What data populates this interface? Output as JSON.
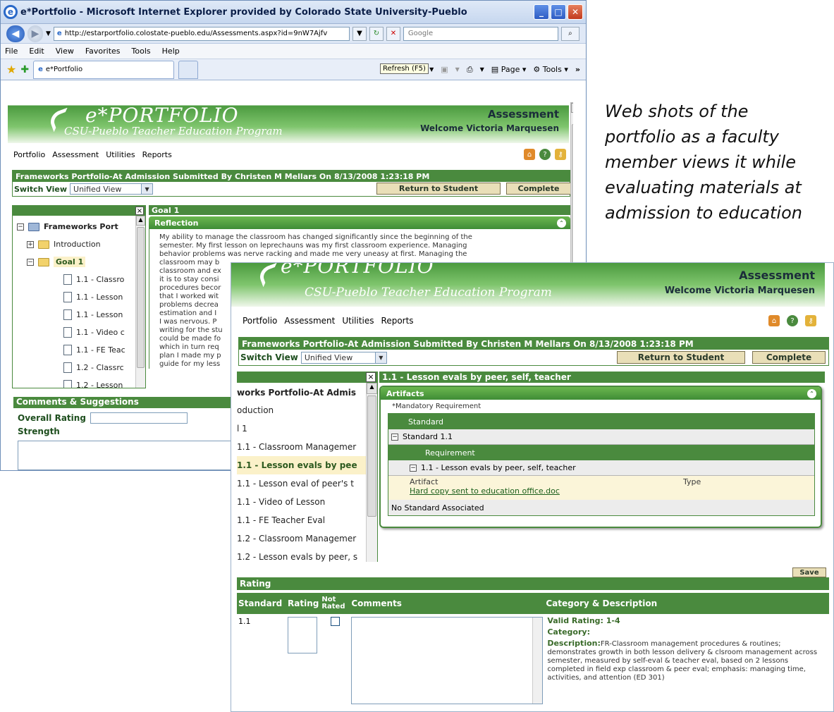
{
  "browser": {
    "title": "e*Portfolio - Microsoft Internet Explorer provided by Colorado State University-Pueblo",
    "url": "http://estarportfolio.colostate-pueblo.edu/Assessments.aspx?id=9nW7Ajfv",
    "search_placeholder": "Google",
    "menu": [
      "File",
      "Edit",
      "View",
      "Favorites",
      "Tools",
      "Help"
    ],
    "tab_label": "e*Portfolio",
    "tooltip": "Refresh (F5)",
    "page_label": "Page",
    "tools_label": "Tools"
  },
  "portal": {
    "logo_main": "e*PORTFOLIO",
    "logo_sub": "CSU-Pueblo Teacher Education Program",
    "page_heading": "Assessment",
    "welcome": "Welcome Victoria Marquesen",
    "nav": [
      "Portfolio",
      "Assessment",
      "Utilities",
      "Reports"
    ],
    "submission_banner": "Frameworks Portfolio-At Admission Submitted By Christen M Mellars On 8/13/2008 1:23:18 PM",
    "switch_view_label": "Switch View",
    "switch_view_value": "Unified View",
    "return_button": "Return to Student",
    "complete_button": "Complete",
    "close_glyph": "×"
  },
  "window1": {
    "goal_header": "Goal 1",
    "reflection_title": "Reflection",
    "tree": [
      {
        "label": "Frameworks Port",
        "kind": "root"
      },
      {
        "label": "Introduction",
        "kind": "folder"
      },
      {
        "label": "Goal 1",
        "kind": "folder-open"
      },
      {
        "label": "1.1 - Classro",
        "kind": "doc"
      },
      {
        "label": "1.1 - Lesson",
        "kind": "doc"
      },
      {
        "label": "1.1 - Lesson",
        "kind": "doc"
      },
      {
        "label": "1.1 - Video c",
        "kind": "doc"
      },
      {
        "label": "1.1 - FE Teac",
        "kind": "doc"
      },
      {
        "label": "1.2 - Classrc",
        "kind": "doc"
      },
      {
        "label": "1.2 - Lesson",
        "kind": "doc"
      }
    ],
    "reflection_lines": [
      "My ability to manage the classroom has changed significantly since the beginning of the",
      "semester. My first lesson on leprechauns was my first classroom experience. Managing",
      "behavior problems was nerve racking and made me very uneasy at first. Managing the",
      "classroom may b",
      "classroom and ex",
      "it is to stay consi",
      "procedures becor",
      "that I worked wit",
      "problems decrea",
      "estimation and I",
      "I was nervous. P",
      "writing for the stu",
      "could be made fo",
      "which in turn req",
      "plan I made my p",
      "guide for my less"
    ],
    "comments_title": "Comments & Suggestions",
    "overall_rating_label": "Overall Rating",
    "strength_label": "Strength"
  },
  "caption": {
    "lines": [
      "Web shots of the",
      "portfolio as a faculty",
      "member views it while",
      "evaluating materials at",
      "admission to education"
    ]
  },
  "window2": {
    "item_header": "1.1 - Lesson evals by peer, self, teacher",
    "tree": [
      {
        "label": "works Portfolio-At Admis",
        "bold": true
      },
      {
        "label": "oduction",
        "bold": false
      },
      {
        "label": "l 1",
        "bold": false
      },
      {
        "label": "1.1 - Classroom Managemer",
        "bold": false
      },
      {
        "label": "1.1 - Lesson evals by pee",
        "bold": true,
        "selected": true
      },
      {
        "label": "1.1 - Lesson eval of peer's t",
        "bold": false
      },
      {
        "label": "1.1 - Video of Lesson",
        "bold": false
      },
      {
        "label": "1.1 - FE Teacher Eval",
        "bold": false
      },
      {
        "label": "1.2 - Classroom Managemer",
        "bold": false
      },
      {
        "label": "1.2 - Lesson evals by peer, s",
        "bold": false
      }
    ],
    "artifacts_title": "Artifacts",
    "mandatory_note": "*Mandatory Requirement",
    "standard_header": "Standard",
    "standard_row": "Standard 1.1",
    "requirement_header": "Requirement",
    "requirement_row": "1.1 - Lesson evals by peer, self, teacher",
    "artifact_col": "Artifact",
    "type_col": "Type",
    "artifact_link": "Hard copy sent to education office.doc",
    "no_standard": "No Standard Associated",
    "save_partial": "Save",
    "rating_title": "Rating",
    "rating_columns": [
      "Standard",
      "Rating",
      "Not Rated",
      "Comments",
      "Category & Description"
    ],
    "rating_row": {
      "standard": "1.1",
      "valid_rating": "Valid Rating: 1-4",
      "category": "Category:",
      "description_label": "Description:",
      "description": "FR-Classroom management procedures & routines; demonstrates growth in both lesson delivery & clsroom management across semester, measured by self-eval & teacher eval, based on 2 lessons completed in field exp classroom & peer eval; emphasis: managing time, activities, and attention (ED 301)"
    }
  },
  "colors": {
    "brand_green": "#4a8a3e",
    "button_tan": "#e9dfb8",
    "link_green": "#1a5e1a"
  }
}
